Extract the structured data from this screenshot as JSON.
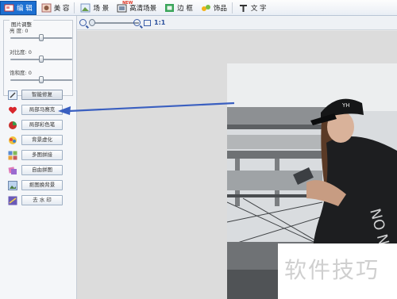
{
  "toolbar": {
    "tabs": [
      {
        "label": "编 辑",
        "icon": "edit-icon"
      },
      {
        "label": "美 容",
        "icon": "face-icon"
      },
      {
        "label": "场 景",
        "icon": "scene-icon"
      },
      {
        "label": "高清场景",
        "icon": "hd-scene-icon"
      },
      {
        "label": "边 框",
        "icon": "frame-icon"
      },
      {
        "label": "饰品",
        "icon": "accessory-icon"
      },
      {
        "label": "文 字",
        "icon": "text-icon"
      }
    ],
    "hd_badge": "NEW"
  },
  "adjust": {
    "title": "图片调整",
    "sliders": [
      {
        "label": "亮   度: 0",
        "value": 0
      },
      {
        "label": "对比度: 0",
        "value": 0
      },
      {
        "label": "饱和度: 0",
        "value": 0
      }
    ]
  },
  "functions": [
    {
      "label": "智能修复"
    },
    {
      "label": "局部马赛克"
    },
    {
      "label": "局部彩色笔"
    },
    {
      "label": "背景虚化"
    },
    {
      "label": "多图拼接"
    },
    {
      "label": "自由拼图"
    },
    {
      "label": "抠图换背景"
    },
    {
      "label": "去 水 印"
    }
  ],
  "zoom": {
    "ratio": "1:1"
  },
  "photo": {
    "cap_text": "YH",
    "shirt_text": "NO N"
  },
  "watermark": {
    "text": "软件技巧"
  },
  "colors": {
    "accent": "#1c6fd1",
    "arrow": "#3a5fc0"
  }
}
